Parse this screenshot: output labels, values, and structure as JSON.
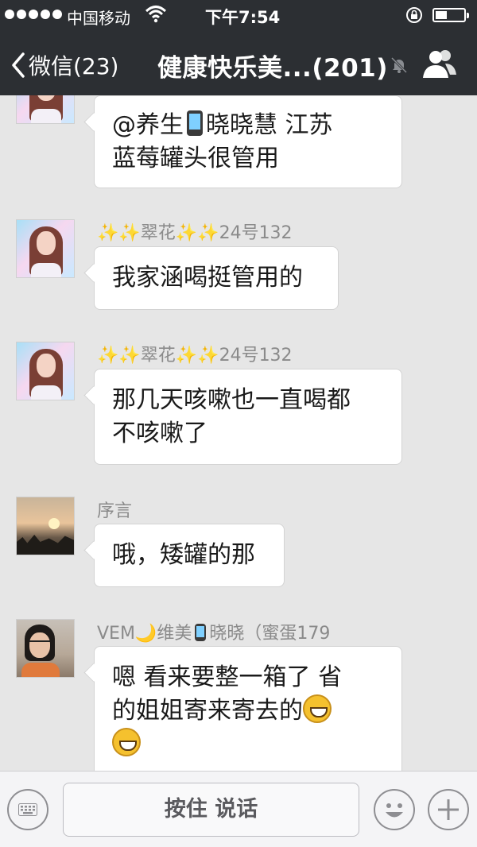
{
  "status_bar": {
    "carrier": "中国移动",
    "time": "下午7:54",
    "signal_icon": "signal-dots-icon",
    "wifi_icon": "wifi-icon",
    "lock_icon": "rotation-lock-icon",
    "battery_icon": "battery-icon"
  },
  "nav": {
    "back_label": "微信(23)",
    "title": "健康快乐美...(201)",
    "mute_icon": "mute-bell-icon",
    "group_icon": "group-members-icon"
  },
  "messages": [
    {
      "sender": "",
      "text_lines": [
        "@养生",
        "晓晓慧  江苏",
        "蓝莓罐头很管用"
      ]
    },
    {
      "sender_parts": [
        "✨✨翠花✨✨24号132"
      ],
      "text": "我家涵喝挺管用的"
    },
    {
      "sender_parts": [
        "✨✨翠花✨✨24号132"
      ],
      "text_lines": [
        "那几天咳嗽也一直喝都",
        "不咳嗽了"
      ]
    },
    {
      "sender_parts": [
        "序言"
      ],
      "text": "哦，矮罐的那"
    },
    {
      "sender_parts": [
        "VEM🌙维美",
        "晓晓（蜜蛋179"
      ],
      "text_lines": [
        "嗯 看来要整一箱了 省",
        "的姐姐寄来寄去的"
      ]
    }
  ],
  "input": {
    "talk_label": "按住 说话",
    "keyboard_icon": "keyboard-icon",
    "emoji_icon": "emoji-icon",
    "plus_icon": "plus-icon"
  }
}
